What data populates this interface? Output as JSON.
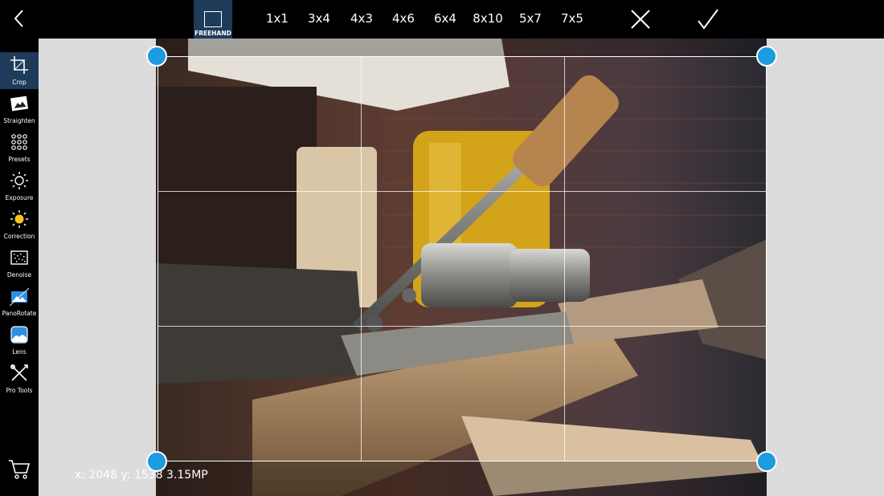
{
  "toolbar": {
    "freehand_label": "FREEHAND",
    "ratios": [
      "1x1",
      "3x4",
      "4x3",
      "4x6",
      "6x4",
      "8x10",
      "5x7",
      "7x5"
    ]
  },
  "sidebar": {
    "items": [
      {
        "label": "Crop",
        "icon": "crop-icon",
        "active": true
      },
      {
        "label": "Straighten",
        "icon": "straighten-icon"
      },
      {
        "label": "Presets",
        "icon": "presets-icon"
      },
      {
        "label": "Exposure",
        "icon": "exposure-icon"
      },
      {
        "label": "Correction",
        "icon": "correction-icon"
      },
      {
        "label": "Denoise",
        "icon": "denoise-icon"
      },
      {
        "label": "PanoRotate",
        "icon": "panorotate-icon"
      },
      {
        "label": "Lens",
        "icon": "lens-icon"
      },
      {
        "label": "Pro Tools",
        "icon": "pro-tools-icon"
      }
    ]
  },
  "status": {
    "info": "x: 2048 y: 1538  3.15MP"
  },
  "colors": {
    "accent": "#1d9be0",
    "selected_bg": "#1f3b5a",
    "canvas_bg": "#dcdcdc"
  }
}
